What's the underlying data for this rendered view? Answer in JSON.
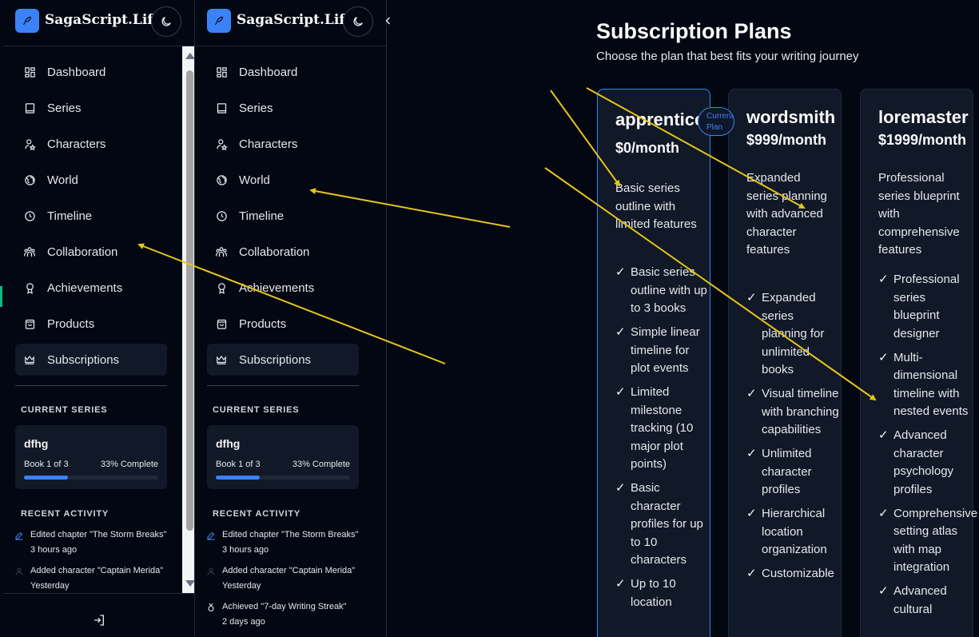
{
  "app": {
    "brand": "SagaScript.Life"
  },
  "sidebar": {
    "items": [
      {
        "label": "Dashboard",
        "icon": "dashboard-icon"
      },
      {
        "label": "Series",
        "icon": "book-icon"
      },
      {
        "label": "Characters",
        "icon": "user-star-icon"
      },
      {
        "label": "World",
        "icon": "globe-icon"
      },
      {
        "label": "Timeline",
        "icon": "clock-icon"
      },
      {
        "label": "Collaboration",
        "icon": "users-icon"
      },
      {
        "label": "Achievements",
        "icon": "award-icon"
      },
      {
        "label": "Products",
        "icon": "shopping-bag-icon"
      },
      {
        "label": "Subscriptions",
        "icon": "crown-icon",
        "active": true
      }
    ],
    "current_series_title": "CURRENT SERIES",
    "series": {
      "name": "dfhg",
      "book": "Book 1 of 3",
      "complete": "33% Complete",
      "progress": 0.33
    },
    "recent_activity_title": "RECENT ACTIVITY",
    "activity": [
      {
        "text": "Edited chapter \"The Storm Breaks\"",
        "time": "3 hours ago",
        "icon": "edit-icon"
      },
      {
        "text": "Added character \"Captain Merida\"",
        "time": "Yesterday",
        "icon": "user-icon"
      },
      {
        "text": "Achieved \"7-day Writing Streak\"",
        "time": "2 days ago",
        "icon": "medal-icon"
      }
    ]
  },
  "main": {
    "title": "Subscription Plans",
    "subtitle": "Choose the plan that best fits your writing journey",
    "current_badge": "Current Plan",
    "plans": [
      {
        "name": "apprentice",
        "price": "$0/month",
        "description": "Basic series outline with limited features",
        "features": [
          "Basic series outline with up to 3 books",
          "Simple linear timeline for plot events",
          "Limited milestone tracking (10 major plot points)",
          "Basic character profiles for up to 10 characters",
          "Up to 10 location"
        ]
      },
      {
        "name": "wordsmith",
        "price": "$999/month",
        "description": "Expanded series planning with advanced character features",
        "features": [
          "Expanded series planning for unlimited books",
          "Visual timeline with branching capabilities",
          "Unlimited character profiles",
          "Hierarchical location organization",
          "Customizable"
        ]
      },
      {
        "name": "loremaster",
        "price": "$1999/month",
        "description": "Professional series blueprint with comprehensive features",
        "features": [
          "Professional series blueprint designer",
          "Multi-dimensional timeline with nested events",
          "Advanced character psychology profiles",
          "Comprehensive setting atlas with map integration",
          "Advanced cultural"
        ]
      }
    ]
  },
  "colors": {
    "accent": "#3b82f6",
    "background": "#030712",
    "card": "#111827",
    "annotation": "#e6c619"
  }
}
